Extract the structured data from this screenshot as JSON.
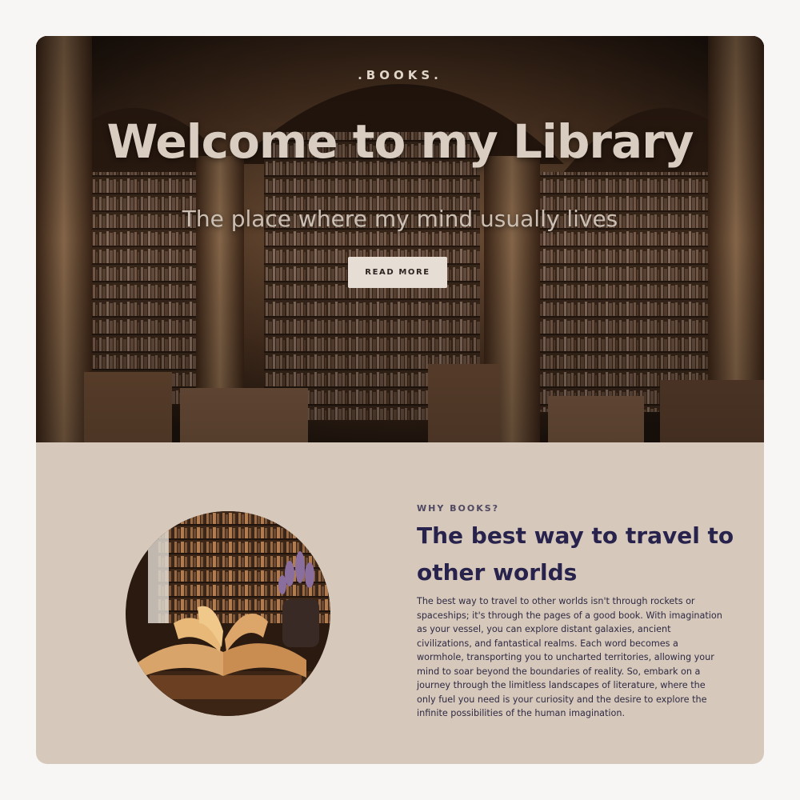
{
  "hero": {
    "brand": ".BOOKS.",
    "title": "Welcome to my Library",
    "subtitle": "The place where my mind usually lives",
    "cta_label": "READ MORE"
  },
  "about": {
    "eyebrow": "WHY BOOKS?",
    "title": "The best way to travel to other worlds",
    "body": "The best way to travel to other worlds isn't through rockets or spaceships; it's through the pages of a good book. With imagination as your vessel, you can explore distant galaxies, ancient civilizations, and fantastical realms. Each word becomes a wormhole, transporting you to uncharted territories, allowing your mind to soar beyond the boundaries of reality. So, embark on a journey through the limitless landscapes of literature, where the only fuel you need is your curiosity and the desire to explore the infinite possibilities of the human imagination."
  },
  "colors": {
    "page_background": "#f8f6f4",
    "section_background": "#d6c8ba",
    "heading_navy": "#28234c",
    "hero_text": "#d9cdc1",
    "button_background": "#e6ddd4"
  },
  "images": {
    "hero_background": "library-hall-image",
    "about_image": "open-book-image"
  }
}
